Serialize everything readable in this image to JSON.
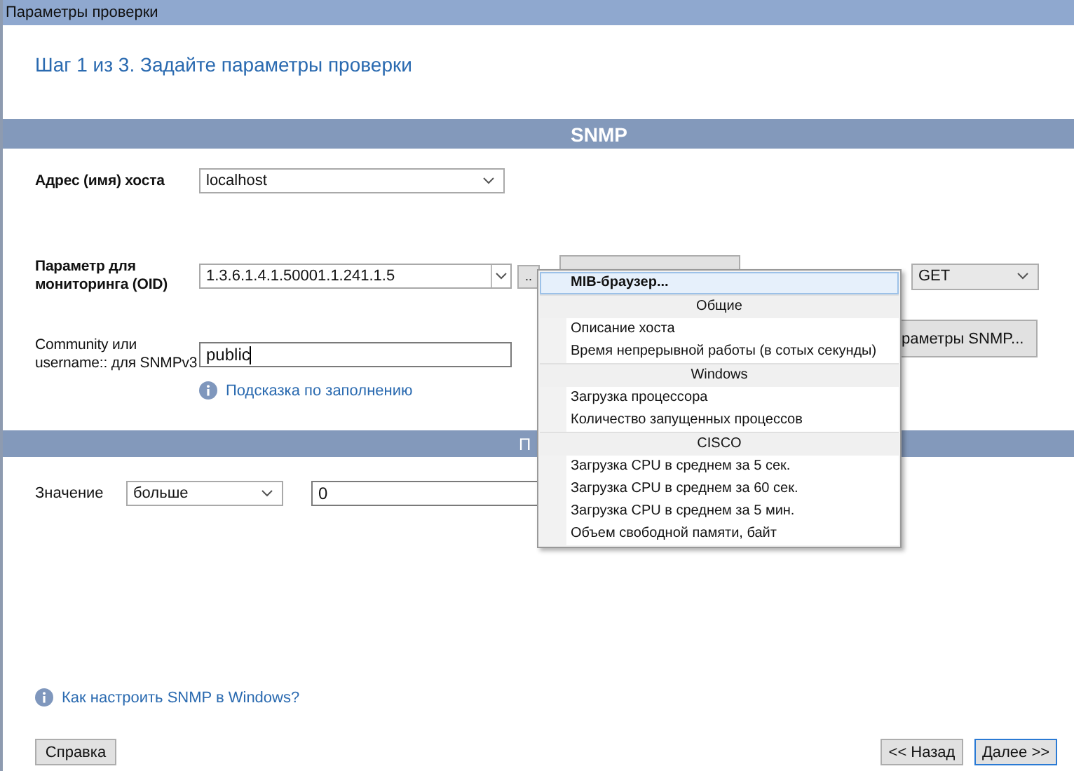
{
  "window": {
    "title": "Параметры проверки"
  },
  "step_title": "Шаг 1 из 3. Задайте параметры проверки",
  "snmp_section": {
    "title": "SNMP"
  },
  "host": {
    "label": "Адрес (имя) хоста",
    "value": "localhost"
  },
  "oid": {
    "label": "Параметр для мониторинга (OID)",
    "value": "1.3.6.1.4.1.50001.1.241.1.5",
    "browse_button": "..",
    "method": "GET"
  },
  "community": {
    "label": "Community или username:: для SNMPv3",
    "value": "public",
    "hint_link": "Подсказка по заполнению",
    "params_button": "раметры SNMP..."
  },
  "condition_section": {
    "title": "П"
  },
  "condition": {
    "label": "Значение",
    "operator": "больше",
    "value": "0"
  },
  "help_link": "Как настроить SNMP в Windows?",
  "buttons": {
    "help": "Справка",
    "back": "<< Назад",
    "next": "Далее >>"
  },
  "menu": [
    {
      "kind": "item",
      "label": "MIB-браузер...",
      "bold": true,
      "selected": true
    },
    {
      "kind": "header",
      "label": "Общие"
    },
    {
      "kind": "item",
      "label": "Описание хоста",
      "bold": false,
      "selected": false
    },
    {
      "kind": "item",
      "label": "Время непрерывной работы (в сотых секунды)",
      "bold": false,
      "selected": false
    },
    {
      "kind": "header",
      "label": "Windows"
    },
    {
      "kind": "item",
      "label": "Загрузка процессора",
      "bold": false,
      "selected": false
    },
    {
      "kind": "item",
      "label": "Количество запущенных процессов",
      "bold": false,
      "selected": false
    },
    {
      "kind": "header",
      "label": "CISCO"
    },
    {
      "kind": "item",
      "label": "Загрузка CPU в среднем за 5 сек.",
      "bold": false,
      "selected": false
    },
    {
      "kind": "item",
      "label": "Загрузка CPU в среднем за 60 сек.",
      "bold": false,
      "selected": false
    },
    {
      "kind": "item",
      "label": "Загрузка CPU в среднем за 5 мин.",
      "bold": false,
      "selected": false
    },
    {
      "kind": "item",
      "label": "Объем свободной памяти, байт",
      "bold": false,
      "selected": false
    }
  ]
}
